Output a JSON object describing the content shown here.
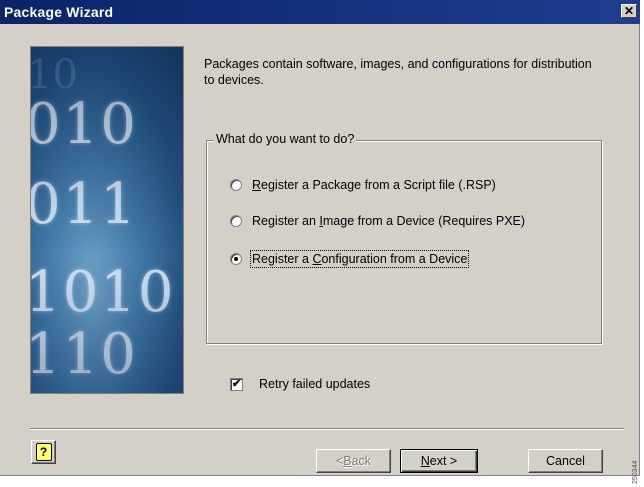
{
  "window": {
    "title": "Package Wizard",
    "close_glyph": "✕"
  },
  "description": "Packages contain software, images, and configurations for distribution to devices.",
  "group": {
    "legend": "What do you want to do?",
    "options": [
      {
        "pre": "",
        "mnemonic": "R",
        "post": "egister a Package from a Script file (.RSP)",
        "checked": false
      },
      {
        "pre": "Register an ",
        "mnemonic": "I",
        "post": "mage from a Device (Requires PXE)",
        "checked": false
      },
      {
        "pre": "Register a ",
        "mnemonic": "C",
        "post": "onfiguration from a Device",
        "checked": true
      }
    ]
  },
  "retry": {
    "label": "Retry failed updates",
    "checked": true,
    "check_glyph": "✔"
  },
  "buttons": {
    "help_glyph": "?",
    "back_prefix": "< ",
    "back_mnemonic": "B",
    "back_suffix": "ack",
    "next_mnemonic": "N",
    "next_suffix": "ext >",
    "cancel": "Cancel"
  },
  "side_number": "250344",
  "banner": {
    "digit_rows": [
      "010",
      "011",
      "1010",
      "110"
    ]
  },
  "colors": {
    "titlebar": "#0a246a",
    "window_bg": "#d4d0c8"
  }
}
